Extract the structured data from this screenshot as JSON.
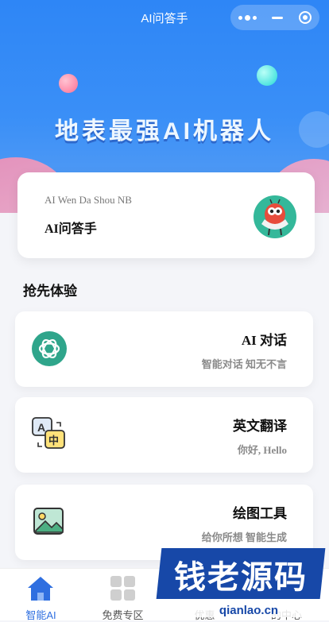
{
  "nav": {
    "title": "AI问答手"
  },
  "hero": {
    "slogan": "地表最强AI机器人"
  },
  "info_card": {
    "subtitle": "AI Wen Da Shou NB",
    "title": "AI问答手"
  },
  "section": {
    "title": "抢先体验"
  },
  "features": [
    {
      "title": "AI 对话",
      "desc": "智能对话 知无不言",
      "icon": "chatgpt-logo-icon"
    },
    {
      "title": "英文翻译",
      "desc": "你好, Hello",
      "icon": "translate-icon"
    },
    {
      "title": "绘图工具",
      "desc": "给你所想 智能生成",
      "icon": "image-icon"
    }
  ],
  "tabbar": {
    "items": [
      {
        "label": "智能AI",
        "icon": "home-icon",
        "active": true
      },
      {
        "label": "免费专区",
        "icon": "grid-icon",
        "active": false
      },
      {
        "label": "优惠",
        "icon": "",
        "active": false
      },
      {
        "label": "的中心",
        "icon": "",
        "active": false
      }
    ]
  },
  "watermark": {
    "text": "钱老源码",
    "url": "qianlao.cn"
  },
  "colors": {
    "primary": "#2e86f6",
    "accent_teal": "#34b89a",
    "tab_active": "#2f6fe0"
  }
}
